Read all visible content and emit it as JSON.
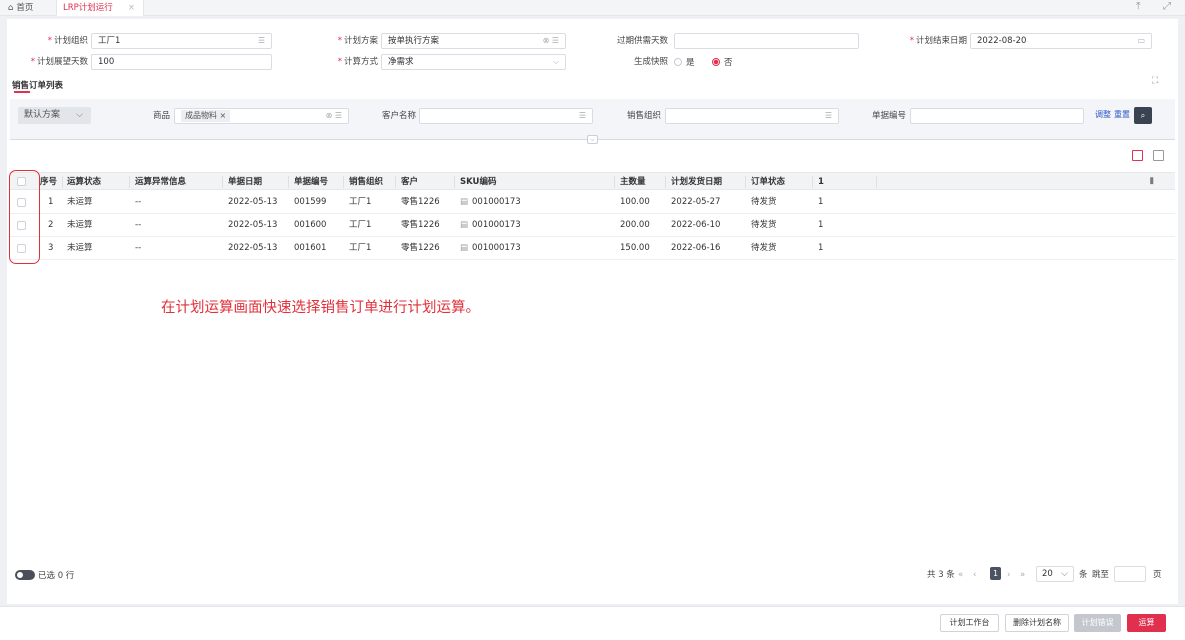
{
  "tabs": {
    "home": "首页",
    "active": "LRP计划运行",
    "close": "×"
  },
  "form": {
    "plan_org_label": "计划组织",
    "plan_org_value": "工厂1",
    "plan_scheme_label": "计划方案",
    "plan_scheme_value": "按单执行方案",
    "overdue_label": "过期供需天数",
    "overdue_value": "",
    "end_date_label": "计划结束日期",
    "end_date_value": "2022-08-20",
    "horizon_label": "计划展望天数",
    "horizon_value": "100",
    "calc_method_label": "计算方式",
    "calc_method_value": "净需求",
    "snapshot_label": "生成快照",
    "snapshot_yes": "是",
    "snapshot_no": "否",
    "snapshot_selected": "否"
  },
  "section": {
    "title": "销售订单列表"
  },
  "filter": {
    "scheme": "默认方案",
    "goods_label": "商品",
    "goods_tag": "成品物料",
    "customer_label": "客户名称",
    "sales_org_label": "销售组织",
    "doc_no_label": "单据编号",
    "adjust": "调整",
    "reset": "重置"
  },
  "table": {
    "headers": [
      "序号",
      "运算状态",
      "运算异常信息",
      "单据日期",
      "单据编号",
      "销售组织",
      "客户",
      "SKU编码",
      "主数量",
      "计划发货日期",
      "订单状态",
      "1"
    ],
    "rows": [
      [
        "1",
        "未运算",
        "--",
        "2022-05-13",
        "001599",
        "工厂1",
        "零售1226",
        "001000173",
        "100.00",
        "2022-05-27",
        "待发货",
        "1"
      ],
      [
        "2",
        "未运算",
        "--",
        "2022-05-13",
        "001600",
        "工厂1",
        "零售1226",
        "001000173",
        "200.00",
        "2022-06-10",
        "待发货",
        "1"
      ],
      [
        "3",
        "未运算",
        "--",
        "2022-05-13",
        "001601",
        "工厂1",
        "零售1226",
        "001000173",
        "150.00",
        "2022-06-16",
        "待发货",
        "1"
      ]
    ]
  },
  "annotation": "在计划运算画面快速选择销售订单进行计划运算。",
  "footer": {
    "selected": "已选 0 行",
    "total": "共 3 条",
    "current_page": "1",
    "page_size": "20",
    "per_unit": "条",
    "jump": "跳至",
    "page_unit": "页"
  },
  "buttons": {
    "workbench": "计划工作台",
    "delete_name": "删除计划名称",
    "errors": "计划错误",
    "run": "运算"
  },
  "colors": {
    "accent": "#e0304e",
    "annotation": "#e0303a",
    "link": "#2a56c6"
  }
}
